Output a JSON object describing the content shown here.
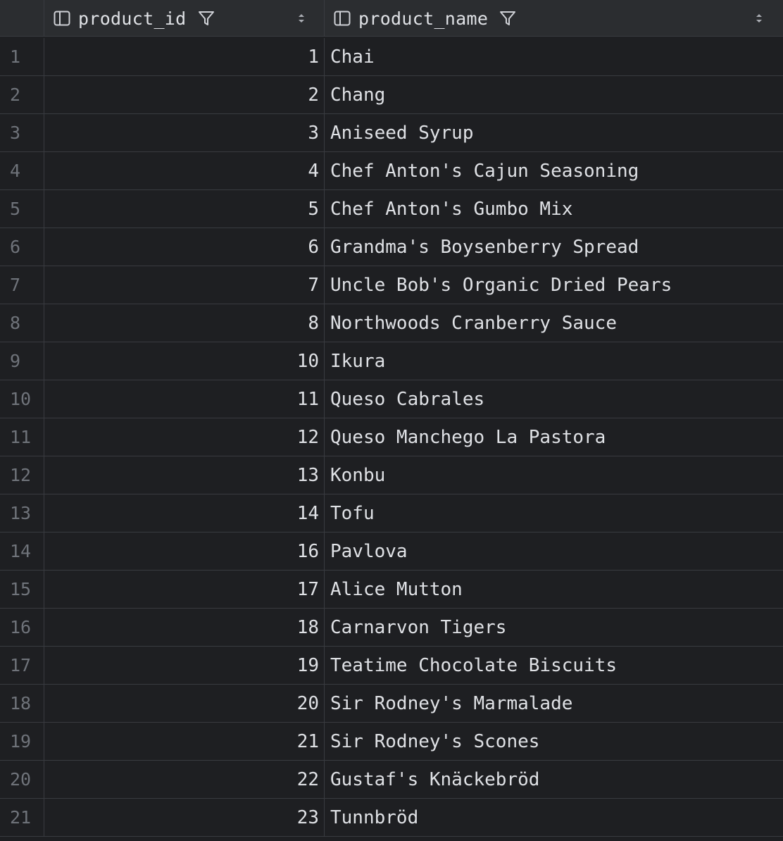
{
  "columns": [
    {
      "title": "product_id",
      "icon": "column-icon",
      "filter": "filter-icon",
      "sort": "sort-icon"
    },
    {
      "title": "product_name",
      "icon": "column-icon",
      "filter": "filter-icon",
      "sort": "sort-icon"
    }
  ],
  "colors": {
    "background": "#1e1f22",
    "header_background": "#2b2d30",
    "grid_line": "#393b40",
    "text": "#dfe1e5",
    "row_number": "#6f737a"
  },
  "rows": [
    {
      "num": "1",
      "product_id": "1",
      "product_name": "Chai"
    },
    {
      "num": "2",
      "product_id": "2",
      "product_name": "Chang"
    },
    {
      "num": "3",
      "product_id": "3",
      "product_name": "Aniseed Syrup"
    },
    {
      "num": "4",
      "product_id": "4",
      "product_name": "Chef Anton's Cajun Seasoning"
    },
    {
      "num": "5",
      "product_id": "5",
      "product_name": "Chef Anton's Gumbo Mix"
    },
    {
      "num": "6",
      "product_id": "6",
      "product_name": "Grandma's Boysenberry Spread"
    },
    {
      "num": "7",
      "product_id": "7",
      "product_name": "Uncle Bob's Organic Dried Pears"
    },
    {
      "num": "8",
      "product_id": "8",
      "product_name": "Northwoods Cranberry Sauce"
    },
    {
      "num": "9",
      "product_id": "10",
      "product_name": "Ikura"
    },
    {
      "num": "10",
      "product_id": "11",
      "product_name": "Queso Cabrales"
    },
    {
      "num": "11",
      "product_id": "12",
      "product_name": "Queso Manchego La Pastora"
    },
    {
      "num": "12",
      "product_id": "13",
      "product_name": "Konbu"
    },
    {
      "num": "13",
      "product_id": "14",
      "product_name": "Tofu"
    },
    {
      "num": "14",
      "product_id": "16",
      "product_name": "Pavlova"
    },
    {
      "num": "15",
      "product_id": "17",
      "product_name": "Alice Mutton"
    },
    {
      "num": "16",
      "product_id": "18",
      "product_name": "Carnarvon Tigers"
    },
    {
      "num": "17",
      "product_id": "19",
      "product_name": "Teatime Chocolate Biscuits"
    },
    {
      "num": "18",
      "product_id": "20",
      "product_name": "Sir Rodney's Marmalade"
    },
    {
      "num": "19",
      "product_id": "21",
      "product_name": "Sir Rodney's Scones"
    },
    {
      "num": "20",
      "product_id": "22",
      "product_name": "Gustaf's Knäckebröd"
    },
    {
      "num": "21",
      "product_id": "23",
      "product_name": "Tunnbröd"
    }
  ]
}
